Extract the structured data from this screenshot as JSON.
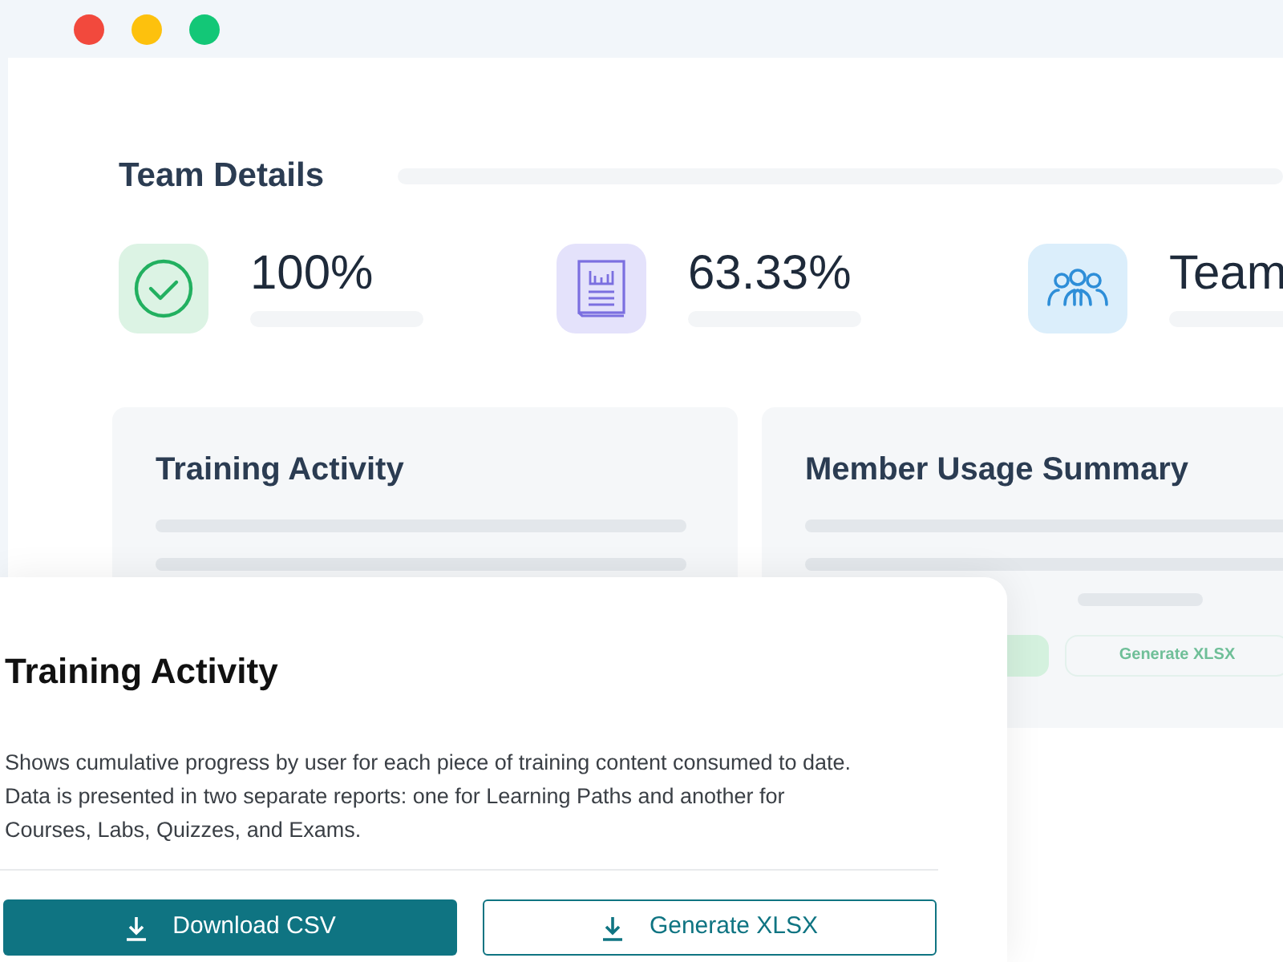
{
  "team_details": {
    "title": "Team Details",
    "stats": [
      {
        "kind": "check",
        "value": "100%"
      },
      {
        "kind": "report",
        "value": "63.33%"
      },
      {
        "kind": "team",
        "value": "Team"
      }
    ]
  },
  "cards": [
    {
      "title": "Training Activity"
    },
    {
      "title": "Member Usage Summary",
      "button": "Generate XLSX"
    }
  ],
  "dialog": {
    "title": "Training Activity",
    "description": "Shows cumulative progress by user for each piece of training content consumed to date. Data is presented in two separate reports: one for Learning Paths and another for Courses, Labs, Quizzes, and Exams.",
    "buttons": [
      {
        "kind": "primary",
        "label": "Download CSV"
      },
      {
        "kind": "outline",
        "label": "Generate XLSX"
      }
    ]
  }
}
